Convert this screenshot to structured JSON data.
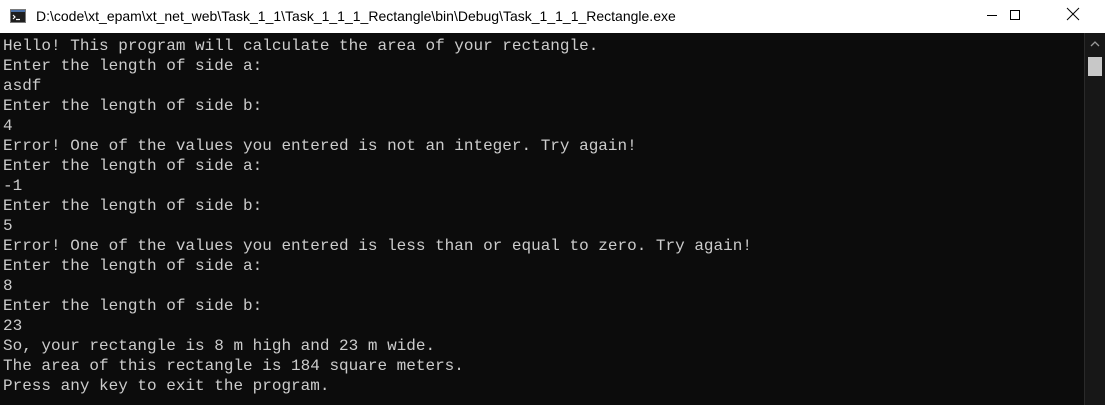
{
  "window": {
    "title": "D:\\code\\xt_epam\\xt_net_web\\Task_1_1\\Task_1_1_1_Rectangle\\bin\\Debug\\Task_1_1_1_Rectangle.exe"
  },
  "icons": {
    "app": "console-app-icon",
    "minimize": "minimize-icon",
    "maximize": "maximize-icon",
    "close": "close-icon",
    "scroll_up": "chevron-up-icon"
  },
  "colors": {
    "terminal_bg": "#0c0c0c",
    "terminal_text": "#cccccc",
    "titlebar_bg": "#ffffff"
  },
  "console": {
    "lines": [
      "Hello! This program will calculate the area of your rectangle.",
      "Enter the length of side a:",
      "asdf",
      "Enter the length of side b:",
      "4",
      "Error! One of the values you entered is not an integer. Try again!",
      "Enter the length of side a:",
      "-1",
      "Enter the length of side b:",
      "5",
      "Error! One of the values you entered is less than or equal to zero. Try again!",
      "Enter the length of side a:",
      "8",
      "Enter the length of side b:",
      "23",
      "So, your rectangle is 8 m high and 23 m wide.",
      "The area of this rectangle is 184 square meters.",
      "Press any key to exit the program."
    ]
  }
}
